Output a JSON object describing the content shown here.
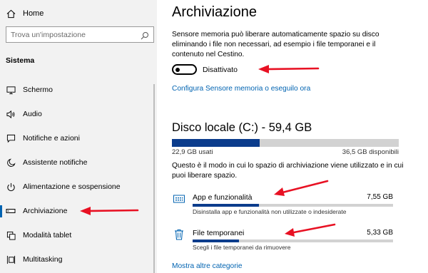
{
  "sidebar": {
    "home_label": "Home",
    "search_placeholder": "Trova un'impostazione",
    "section_title": "Sistema",
    "items": [
      {
        "label": "Schermo",
        "icon": "monitor-icon"
      },
      {
        "label": "Audio",
        "icon": "speaker-icon"
      },
      {
        "label": "Notifiche e azioni",
        "icon": "message-icon"
      },
      {
        "label": "Assistente notifiche",
        "icon": "moon-icon"
      },
      {
        "label": "Alimentazione e sospensione",
        "icon": "power-icon"
      },
      {
        "label": "Archiviazione",
        "icon": "storage-icon",
        "active": true
      },
      {
        "label": "Modalità tablet",
        "icon": "tablet-icon"
      },
      {
        "label": "Multitasking",
        "icon": "multitasking-icon"
      }
    ]
  },
  "main": {
    "title": "Archiviazione",
    "description": "Sensore memoria può liberare automaticamente spazio su disco eliminando i file non necessari, ad esempio i file temporanei e il contenuto nel Cestino.",
    "toggle_label": "Disattivato",
    "toggle_state": "off",
    "configure_link": "Configura Sensore memoria o eseguilo ora",
    "disk": {
      "title": "Disco locale (C:) - 59,4 GB",
      "used_label": "22,9 GB usati",
      "free_label": "36,5 GB disponibili",
      "used_fraction": 0.386
    },
    "disk_description": "Questo è il modo in cui lo spazio di archiviazione viene utilizzato e in cui puoi liberare spazio.",
    "categories": [
      {
        "name": "App e funzionalità",
        "size": "7,55 GB",
        "subtitle": "Disinstalla app e funzionalità non utilizzate o indesiderate",
        "fraction": 0.33,
        "icon": "apps-icon"
      },
      {
        "name": "File temporanei",
        "size": "5,33 GB",
        "subtitle": "Scegli i file temporanei da rimuovere",
        "fraction": 0.23,
        "icon": "trash-icon"
      }
    ],
    "more_link": "Mostra altre categorie"
  },
  "colors": {
    "accent": "#0063b1",
    "bar_fill": "#0b3c8c",
    "bar_track": "#d2d2d2",
    "annotation_arrow": "#e81123"
  }
}
